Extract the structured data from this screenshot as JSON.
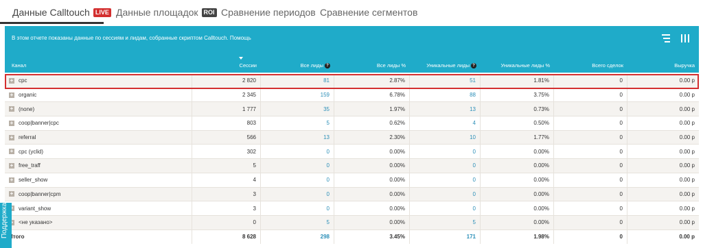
{
  "tabs": [
    {
      "label": "Данные Calltouch",
      "badge": "LIVE"
    },
    {
      "label": "Данные площадок",
      "badge": "ROI"
    },
    {
      "label": "Сравнение периодов"
    },
    {
      "label": "Сравнение сегментов"
    }
  ],
  "info": {
    "text": "В этом отчете показаны данные по сессиям и лидам, собранные скриптом Calltouch.",
    "help_link": "Помощь"
  },
  "icons": {
    "filter": "filter-icon",
    "columns": "columns-icon",
    "help": "question-icon",
    "expand": "plus-icon",
    "sort": "sort-down-icon"
  },
  "colors": {
    "accent": "#1fabc9",
    "highlight": "#d32f2f",
    "link": "#2c8fb8"
  },
  "table": {
    "headers": [
      "Канал",
      "Сессии",
      "Все лиды",
      "Все лиды %",
      "Уникальные лиды",
      "Уникальные лиды %",
      "Всего сделок",
      "Выручка"
    ],
    "rows": [
      [
        "cpc",
        "2 820",
        "81",
        "2.87%",
        "51",
        "1.81%",
        "0",
        "0.00 р"
      ],
      [
        "organic",
        "2 345",
        "159",
        "6.78%",
        "88",
        "3.75%",
        "0",
        "0.00 р"
      ],
      [
        "(none)",
        "1 777",
        "35",
        "1.97%",
        "13",
        "0.73%",
        "0",
        "0.00 р"
      ],
      [
        "coop|banner|cpc",
        "803",
        "5",
        "0.62%",
        "4",
        "0.50%",
        "0",
        "0.00 р"
      ],
      [
        "referral",
        "566",
        "13",
        "2.30%",
        "10",
        "1.77%",
        "0",
        "0.00 р"
      ],
      [
        "cpc (yclid)",
        "302",
        "0",
        "0.00%",
        "0",
        "0.00%",
        "0",
        "0.00 р"
      ],
      [
        "free_traff",
        "5",
        "0",
        "0.00%",
        "0",
        "0.00%",
        "0",
        "0.00 р"
      ],
      [
        "seller_show",
        "4",
        "0",
        "0.00%",
        "0",
        "0.00%",
        "0",
        "0.00 р"
      ],
      [
        "coop|banner|cpm",
        "3",
        "0",
        "0.00%",
        "0",
        "0.00%",
        "0",
        "0.00 р"
      ],
      [
        "variant_show",
        "3",
        "0",
        "0.00%",
        "0",
        "0.00%",
        "0",
        "0.00 р"
      ],
      [
        "<не указано>",
        "0",
        "5",
        "0.00%",
        "5",
        "0.00%",
        "0",
        "0.00 р"
      ]
    ],
    "total": [
      "Итого",
      "8 628",
      "298",
      "3.45%",
      "171",
      "1.98%",
      "0",
      "0.00 р"
    ],
    "highlighted_row": "cpc"
  },
  "support": {
    "label": "Поддержка"
  }
}
